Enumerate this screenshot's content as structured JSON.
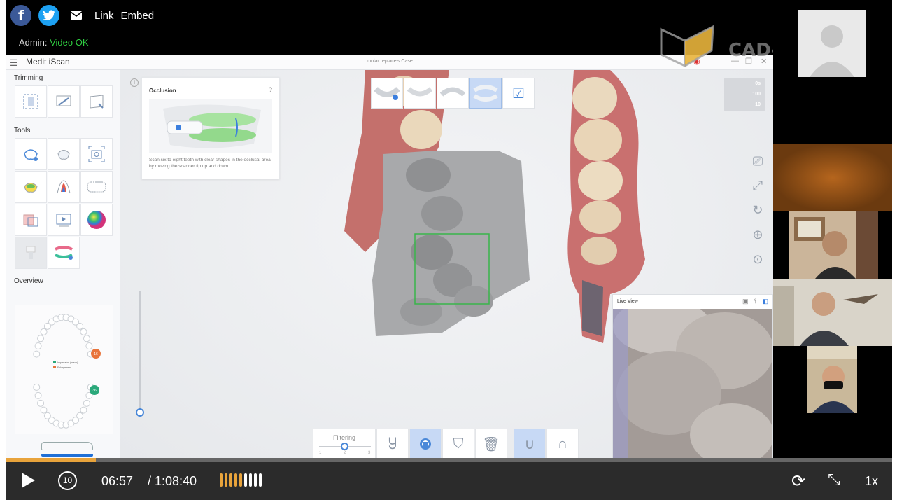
{
  "share": {
    "facebook_glyph": "f",
    "twitter_glyph": "t",
    "link_label": "Link",
    "embed_label": "Embed"
  },
  "admin": {
    "label": "Admin:",
    "status": "Video OK"
  },
  "app": {
    "title": "Medit iScan",
    "case_title": "molar replace's Case",
    "sidebar": {
      "trimming_label": "Trimming",
      "tools_label": "Tools",
      "overview_label": "Overview",
      "legend_items": [
        "Impression (preop)",
        "Enlargement"
      ],
      "tooth_badges": [
        "16",
        "36"
      ]
    },
    "occlusion": {
      "title": "Occlusion",
      "help": "?",
      "description": "Scan six to eight teeth with clear shapes in the occlusal area by moving the scanner tip up and down."
    },
    "stats": [
      "0s",
      "100",
      "10"
    ],
    "filtering_label": "Filtering",
    "filter_ticks": [
      "1",
      "2",
      "3"
    ],
    "filter_level": 0.5,
    "live_view_title": "Live View"
  },
  "watermark": {
    "text": "CAD-RAY.COM"
  },
  "player": {
    "current_time": "06:57",
    "duration": "/ 1:08:40",
    "rewind_label": "10",
    "speed": "1x",
    "progress": 0.101,
    "volume_bars_filled": 5,
    "volume_bars_total": 9,
    "colors": {
      "accent": "#e8a33b",
      "bar": "#2b2b2b"
    }
  }
}
